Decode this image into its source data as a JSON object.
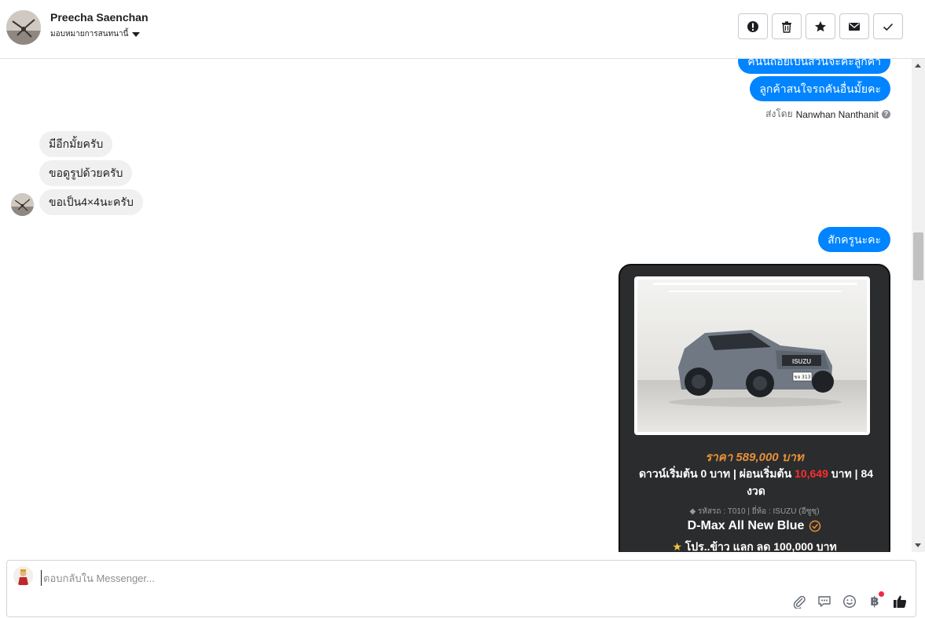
{
  "header": {
    "contact_name": "Preecha Saenchan",
    "assign_label": "มอบหมายการสนทนานี้",
    "actions": [
      {
        "name": "report-button",
        "icon": "exclamation-icon"
      },
      {
        "name": "delete-button",
        "icon": "trash-icon"
      },
      {
        "name": "star-button",
        "icon": "star-icon"
      },
      {
        "name": "mark-unread-button",
        "icon": "envelope-icon"
      },
      {
        "name": "mark-done-button",
        "icon": "check-icon"
      }
    ]
  },
  "conversation": {
    "outgoing_top": [
      {
        "text": "ค้นนี้ถอยเป็นสวนจะคะลูกค้า"
      },
      {
        "text": "ลูกค้าสนใจรถคันอื่นมั้ยคะ"
      }
    ],
    "sent_by_prefix": "ส่งโดย",
    "sent_by_name": "Nanwhan Nanthanit",
    "incoming": [
      {
        "text": "มีอีกมั้ยครับ"
      },
      {
        "text": "ขอดูรูปด้วยครับ"
      },
      {
        "text": "ขอเป็น4×4นะครับ"
      }
    ],
    "outgoing_reply": "สักครูนะคะ",
    "card": {
      "price": "ราคา 589,000 บาท",
      "finance_prefix": "ดาวน์เริ่มต้น 0 บาท | ผ่อนเริ่มต้น",
      "finance_amount": "10,649",
      "finance_suffix": "บาท | 84 งวด",
      "meta": "รหัสรถ : T010 | ยี่ห้อ : ISUZU (อีซูซุ)",
      "model": "D-Max All New Blue",
      "promo": "โปร..ข้าว แลก ลด 100,000 บาท",
      "plate": "ขจ 313"
    }
  },
  "composer": {
    "placeholder": "ตอบกลับใน Messenger...",
    "tools": [
      "paperclip-icon",
      "chat-bubble-icon",
      "emoji-icon",
      "baht-icon",
      "thumbs-up-icon"
    ],
    "baht_symbol": "฿"
  },
  "colors": {
    "accent": "#0084ff",
    "incoming_bubble": "#f0f0f0",
    "card_bg": "#2b2c2e",
    "price": "#e69138",
    "highlight": "#ff2d2d",
    "notification": "#f0284a"
  }
}
